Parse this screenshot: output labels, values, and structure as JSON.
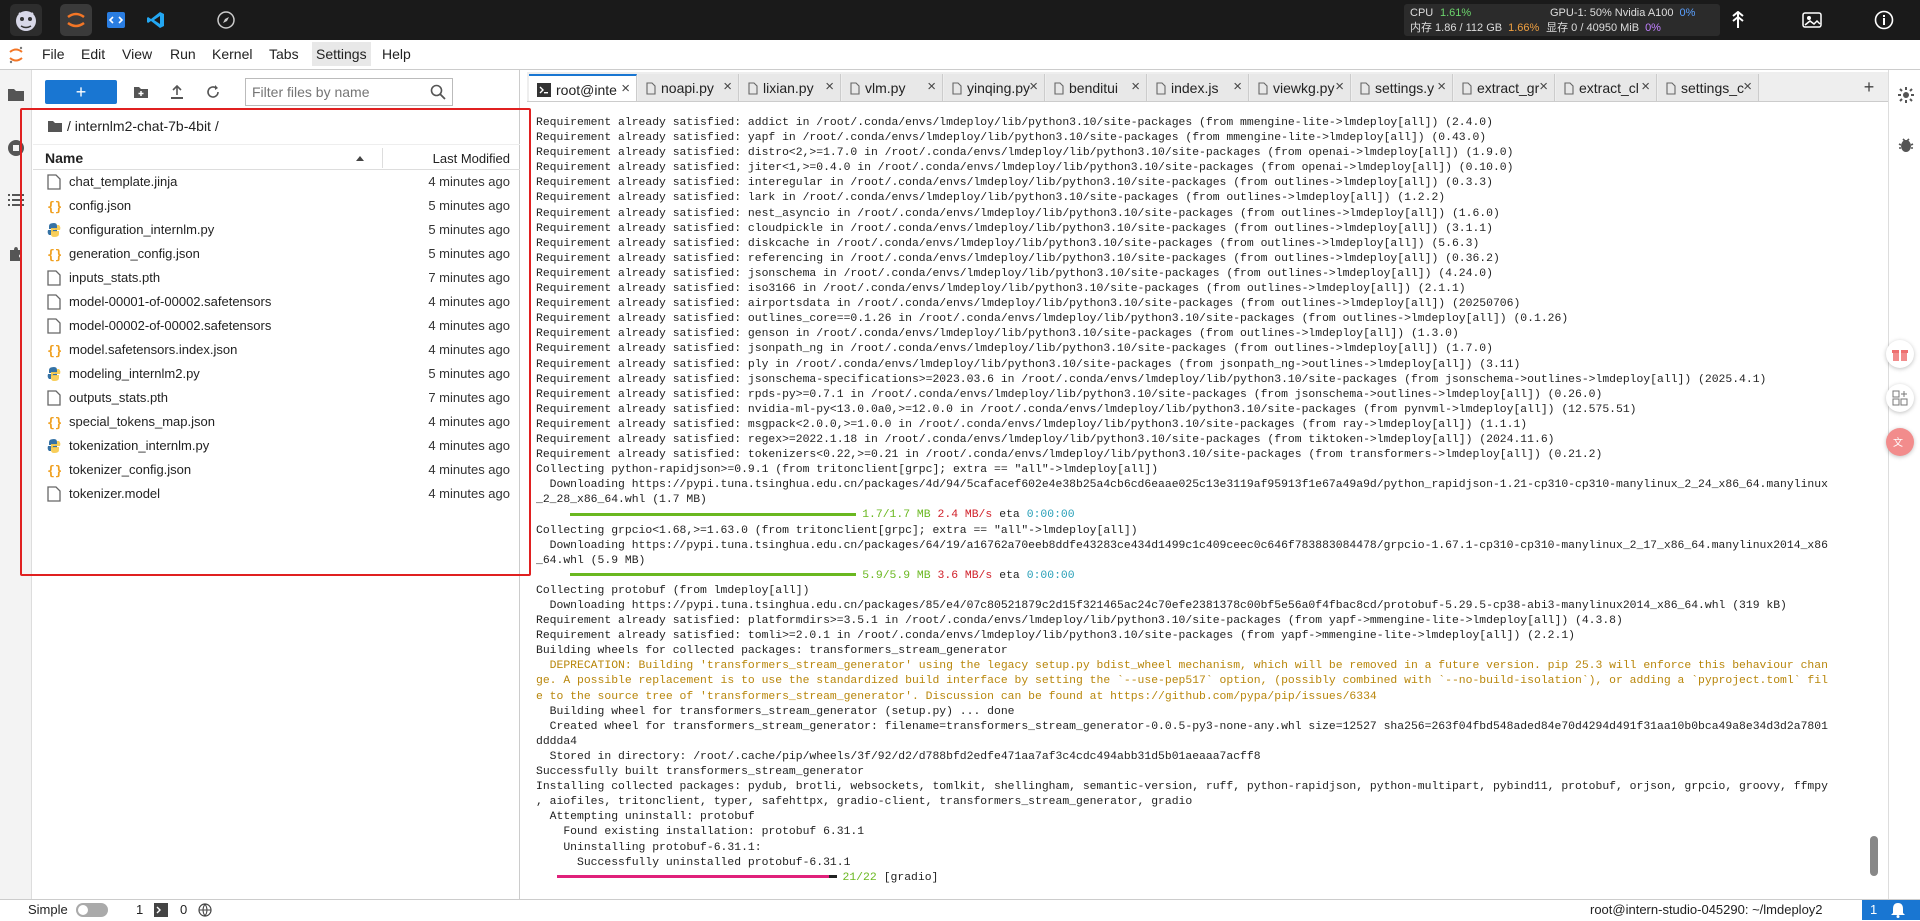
{
  "top": {
    "stats": {
      "cpu_label": "CPU",
      "cpu_val": "1.61%",
      "gpu": "GPU-1: 50% Nvidia A100",
      "gpu_val": "0%",
      "mem_label": "内存 1.86 / 112 GB",
      "mem_val": "1.66%",
      "vram_label": "显存 0 / 40950 MiB",
      "vram_val": "0%"
    }
  },
  "menu": [
    "File",
    "Edit",
    "View",
    "Run",
    "Kernel",
    "Tabs",
    "Settings",
    "Help"
  ],
  "filebrowser": {
    "new_label": "+",
    "filter_placeholder": "Filter files by name",
    "breadcrumb": "/ internlm2-chat-7b-4bit /",
    "col_name": "Name",
    "col_modified": "Last Modified",
    "files": [
      {
        "name": "chat_template.jinja",
        "icon": "file-icon",
        "modified": "4 minutes ago"
      },
      {
        "name": "config.json",
        "icon": "json-icon",
        "modified": "5 minutes ago"
      },
      {
        "name": "configuration_internlm.py",
        "icon": "python-icon",
        "modified": "5 minutes ago"
      },
      {
        "name": "generation_config.json",
        "icon": "json-icon",
        "modified": "5 minutes ago"
      },
      {
        "name": "inputs_stats.pth",
        "icon": "file-icon",
        "modified": "7 minutes ago"
      },
      {
        "name": "model-00001-of-00002.safetensors",
        "icon": "file-icon",
        "modified": "4 minutes ago"
      },
      {
        "name": "model-00002-of-00002.safetensors",
        "icon": "file-icon",
        "modified": "4 minutes ago"
      },
      {
        "name": "model.safetensors.index.json",
        "icon": "json-icon",
        "modified": "4 minutes ago"
      },
      {
        "name": "modeling_internlm2.py",
        "icon": "python-icon",
        "modified": "5 minutes ago"
      },
      {
        "name": "outputs_stats.pth",
        "icon": "file-icon",
        "modified": "7 minutes ago"
      },
      {
        "name": "special_tokens_map.json",
        "icon": "json-icon",
        "modified": "4 minutes ago"
      },
      {
        "name": "tokenization_internlm.py",
        "icon": "python-icon",
        "modified": "4 minutes ago"
      },
      {
        "name": "tokenizer_config.json",
        "icon": "json-icon",
        "modified": "4 minutes ago"
      },
      {
        "name": "tokenizer.model",
        "icon": "file-icon",
        "modified": "4 minutes ago"
      }
    ]
  },
  "tabs": [
    {
      "label": "root@inte",
      "icon": "terminal-icon",
      "active": true
    },
    {
      "label": "noapi.py",
      "icon": "file-icon",
      "active": false
    },
    {
      "label": "lixian.py",
      "icon": "file-icon",
      "active": false
    },
    {
      "label": "vlm.py",
      "icon": "file-icon",
      "active": false
    },
    {
      "label": "yinqing.py",
      "icon": "file-icon",
      "active": false
    },
    {
      "label": "benditui",
      "icon": "file-icon",
      "active": false
    },
    {
      "label": "index.js",
      "icon": "file-icon",
      "active": false
    },
    {
      "label": "viewkg.py",
      "icon": "file-icon",
      "active": false
    },
    {
      "label": "settings.y",
      "icon": "file-icon",
      "active": false
    },
    {
      "label": "extract_gr",
      "icon": "file-icon",
      "active": false
    },
    {
      "label": "extract_cl",
      "icon": "file-icon",
      "active": false
    },
    {
      "label": "settings_c",
      "icon": "file-icon",
      "active": false
    }
  ],
  "new_tab": "+",
  "terminal": [
    {
      "t": "Requirement already satisfied: addict in /root/.conda/envs/lmdeploy/lib/python3.10/site-packages (from mmengine-lite->lmdeploy[all]) (2.4.0)"
    },
    {
      "t": "Requirement already satisfied: yapf in /root/.conda/envs/lmdeploy/lib/python3.10/site-packages (from mmengine-lite->lmdeploy[all]) (0.43.0)"
    },
    {
      "t": "Requirement already satisfied: distro<2,>=1.7.0 in /root/.conda/envs/lmdeploy/lib/python3.10/site-packages (from openai->lmdeploy[all]) (1.9.0)"
    },
    {
      "t": "Requirement already satisfied: jiter<1,>=0.4.0 in /root/.conda/envs/lmdeploy/lib/python3.10/site-packages (from openai->lmdeploy[all]) (0.10.0)"
    },
    {
      "t": "Requirement already satisfied: interegular in /root/.conda/envs/lmdeploy/lib/python3.10/site-packages (from outlines->lmdeploy[all]) (0.3.3)"
    },
    {
      "t": "Requirement already satisfied: lark in /root/.conda/envs/lmdeploy/lib/python3.10/site-packages (from outlines->lmdeploy[all]) (1.2.2)"
    },
    {
      "t": "Requirement already satisfied: nest_asyncio in /root/.conda/envs/lmdeploy/lib/python3.10/site-packages (from outlines->lmdeploy[all]) (1.6.0)"
    },
    {
      "t": "Requirement already satisfied: cloudpickle in /root/.conda/envs/lmdeploy/lib/python3.10/site-packages (from outlines->lmdeploy[all]) (3.1.1)"
    },
    {
      "t": "Requirement already satisfied: diskcache in /root/.conda/envs/lmdeploy/lib/python3.10/site-packages (from outlines->lmdeploy[all]) (5.6.3)"
    },
    {
      "t": "Requirement already satisfied: referencing in /root/.conda/envs/lmdeploy/lib/python3.10/site-packages (from outlines->lmdeploy[all]) (0.36.2)"
    },
    {
      "t": "Requirement already satisfied: jsonschema in /root/.conda/envs/lmdeploy/lib/python3.10/site-packages (from outlines->lmdeploy[all]) (4.24.0)"
    },
    {
      "t": "Requirement already satisfied: iso3166 in /root/.conda/envs/lmdeploy/lib/python3.10/site-packages (from outlines->lmdeploy[all]) (2.1.1)"
    },
    {
      "t": "Requirement already satisfied: airportsdata in /root/.conda/envs/lmdeploy/lib/python3.10/site-packages (from outlines->lmdeploy[all]) (20250706)"
    },
    {
      "t": "Requirement already satisfied: outlines_core==0.1.26 in /root/.conda/envs/lmdeploy/lib/python3.10/site-packages (from outlines->lmdeploy[all]) (0.1.26)"
    },
    {
      "t": "Requirement already satisfied: genson in /root/.conda/envs/lmdeploy/lib/python3.10/site-packages (from outlines->lmdeploy[all]) (1.3.0)"
    },
    {
      "t": "Requirement already satisfied: jsonpath_ng in /root/.conda/envs/lmdeploy/lib/python3.10/site-packages (from outlines->lmdeploy[all]) (1.7.0)"
    },
    {
      "t": "Requirement already satisfied: ply in /root/.conda/envs/lmdeploy/lib/python3.10/site-packages (from jsonpath_ng->outlines->lmdeploy[all]) (3.11)"
    },
    {
      "t": "Requirement already satisfied: jsonschema-specifications>=2023.03.6 in /root/.conda/envs/lmdeploy/lib/python3.10/site-packages (from jsonschema->outlines->lmdeploy[all]) (2025.4.1)"
    },
    {
      "t": "Requirement already satisfied: rpds-py>=0.7.1 in /root/.conda/envs/lmdeploy/lib/python3.10/site-packages (from jsonschema->outlines->lmdeploy[all]) (0.26.0)"
    },
    {
      "t": "Requirement already satisfied: nvidia-ml-py<13.0.0a0,>=12.0.0 in /root/.conda/envs/lmdeploy/lib/python3.10/site-packages (from pynvml->lmdeploy[all]) (12.575.51)"
    },
    {
      "t": "Requirement already satisfied: msgpack<2.0.0,>=1.0.0 in /root/.conda/envs/lmdeploy/lib/python3.10/site-packages (from ray->lmdeploy[all]) (1.1.1)"
    },
    {
      "t": "Requirement already satisfied: regex>=2022.1.18 in /root/.conda/envs/lmdeploy/lib/python3.10/site-packages (from tiktoken->lmdeploy[all]) (2024.11.6)"
    },
    {
      "t": "Requirement already satisfied: tokenizers<0.22,>=0.21 in /root/.conda/envs/lmdeploy/lib/python3.10/site-packages (from transformers->lmdeploy[all]) (0.21.2)"
    },
    {
      "t": "Collecting python-rapidjson>=0.9.1 (from tritonclient[grpc]; extra == \"all\"->lmdeploy[all])"
    },
    {
      "t": "  Downloading https://pypi.tuna.tsinghua.edu.cn/packages/4d/94/5cafacef602e4e38b25a4cb6cd6eaae025c13e3119af95913f1e67a49a9d/python_rapidjson-1.21-cp310-cp310-manylinux_2_24_x86_64.manylinux"
    },
    {
      "t": "_2_28_x86_64.whl (1.7 MB)"
    },
    {
      "t": "",
      "bar": {
        "color": "#6ab820",
        "progress": 1,
        "size": "1.7/1.7 MB",
        "speed": "2.4 MB/s",
        "eta": "eta",
        "etav": "0:00:00"
      }
    },
    {
      "t": "Collecting grpcio<1.68,>=1.63.0 (from tritonclient[grpc]; extra == \"all\"->lmdeploy[all])"
    },
    {
      "t": "  Downloading https://pypi.tuna.tsinghua.edu.cn/packages/64/19/a16762a70eeb8ddfe43283ce434d1499c1c409ceec0c646f783883084478/grpcio-1.67.1-cp310-cp310-manylinux_2_17_x86_64.manylinux2014_x86"
    },
    {
      "t": "_64.whl (5.9 MB)"
    },
    {
      "t": "",
      "bar": {
        "color": "#6ab820",
        "progress": 1,
        "size": "5.9/5.9 MB",
        "speed": "3.6 MB/s",
        "eta": "eta",
        "etav": "0:00:00"
      }
    },
    {
      "t": "Collecting protobuf (from lmdeploy[all])"
    },
    {
      "t": "  Downloading https://pypi.tuna.tsinghua.edu.cn/packages/85/e4/07c80521879c2d15f321465ac24c70efe2381378c00bf5e56a0f4fbac8cd/protobuf-5.29.5-cp38-abi3-manylinux2014_x86_64.whl (319 kB)"
    },
    {
      "t": "Requirement already satisfied: platformdirs>=3.5.1 in /root/.conda/envs/lmdeploy/lib/python3.10/site-packages (from yapf->mmengine-lite->lmdeploy[all]) (4.3.8)"
    },
    {
      "t": "Requirement already satisfied: tomli>=2.0.1 in /root/.conda/envs/lmdeploy/lib/python3.10/site-packages (from yapf->mmengine-lite->lmdeploy[all]) (2.2.1)"
    },
    {
      "t": "Building wheels for collected packages: transformers_stream_generator"
    },
    {
      "t": "  DEPRECATION: Building 'transformers_stream_generator' using the legacy setup.py bdist_wheel mechanism, which will be removed in a future version. pip 25.3 will enforce this behaviour chan",
      "warn": true
    },
    {
      "t": "ge. A possible replacement is to use the standardized build interface by setting the `--use-pep517` option, (possibly combined with `--no-build-isolation`), or adding a `pyproject.toml` fil",
      "warn": true
    },
    {
      "t": "e to the source tree of 'transformers_stream_generator'. Discussion can be found at https://github.com/pypa/pip/issues/6334",
      "warn": true
    },
    {
      "t": "  Building wheel for transformers_stream_generator (setup.py) ... done"
    },
    {
      "t": "  Created wheel for transformers_stream_generator: filename=transformers_stream_generator-0.0.5-py3-none-any.whl size=12527 sha256=263f04fbd548aded84e70d4294d491f31aa10b0bca49a8e34d3d2a7801"
    },
    {
      "t": "dddda4"
    },
    {
      "t": "  Stored in directory: /root/.cache/pip/wheels/3f/92/d2/d788bfd2edfe471aa7af3c4cdc494abb31d5b01aeaaa7acff8"
    },
    {
      "t": "Successfully built transformers_stream_generator"
    },
    {
      "t": "Installing collected packages: pydub, brotli, websockets, tomlkit, shellingham, semantic-version, ruff, python-rapidjson, python-multipart, pybind11, protobuf, orjson, grpcio, groovy, ffmpy"
    },
    {
      "t": ", aiofiles, tritonclient, typer, safehttpx, gradio-client, transformers_stream_generator, gradio"
    },
    {
      "t": "  Attempting uninstall: protobuf"
    },
    {
      "t": "    Found existing installation: protobuf 6.31.1"
    },
    {
      "t": "    Uninstalling protobuf-6.31.1:"
    },
    {
      "t": "      Successfully uninstalled protobuf-6.31.1"
    },
    {
      "t": "",
      "bar": {
        "color": "#e0207a",
        "progress": 0.95,
        "size": "21/22",
        "speed": "",
        "eta": "[gradio]",
        "etav": ""
      }
    }
  ],
  "status": {
    "mode": "Simple",
    "count1": "1",
    "count2": "0",
    "host": "root@intern-studio-045290: ~/lmdeploy2",
    "notif": "1"
  }
}
